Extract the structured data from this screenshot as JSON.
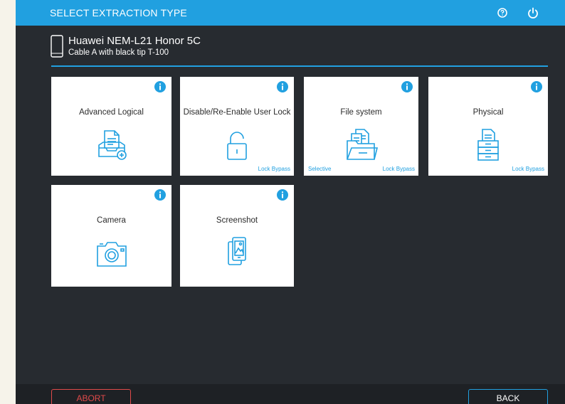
{
  "header": {
    "title": "SELECT EXTRACTION TYPE",
    "help_icon": "help-circle-icon",
    "power_icon": "power-icon"
  },
  "device": {
    "icon": "smartphone-icon",
    "name": "Huawei NEM-L21 Honor 5C",
    "cable": "Cable A with black tip T-100"
  },
  "tiles": [
    {
      "label": "Advanced Logical",
      "icon": "document-tray-add-icon",
      "tag_left": "",
      "tag_right": ""
    },
    {
      "label": "Disable/Re-Enable User Lock",
      "icon": "padlock-icon",
      "tag_left": "",
      "tag_right": "Lock Bypass"
    },
    {
      "label": "File system",
      "icon": "folder-documents-icon",
      "tag_left": "Selective",
      "tag_right": "Lock Bypass"
    },
    {
      "label": "Physical",
      "icon": "document-drawers-icon",
      "tag_left": "",
      "tag_right": "Lock Bypass"
    },
    {
      "label": "Camera",
      "icon": "camera-icon",
      "tag_left": "",
      "tag_right": ""
    },
    {
      "label": "Screenshot",
      "icon": "screenshot-icon",
      "tag_left": "",
      "tag_right": ""
    }
  ],
  "footer": {
    "abort_label": "ABORT",
    "back_label": "BACK"
  },
  "colors": {
    "accent": "#21a0e0",
    "background": "#272b30",
    "abort": "#e04a4a"
  }
}
